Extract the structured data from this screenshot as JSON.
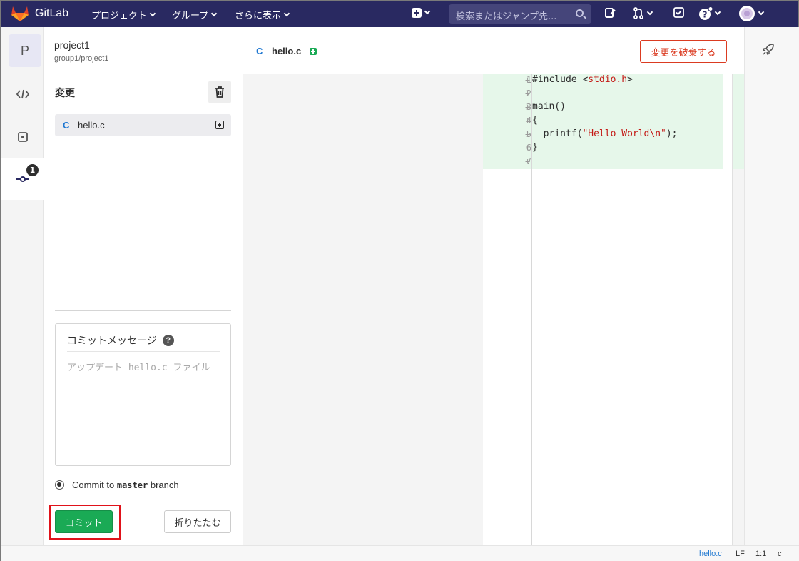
{
  "app": {
    "name": "GitLab"
  },
  "nav": {
    "projects": "プロジェクト",
    "groups": "グループ",
    "more": "さらに表示",
    "search_placeholder": "検索またはジャンプ先..."
  },
  "project": {
    "avatar_letter": "P",
    "name": "project1",
    "path": "group1/project1"
  },
  "rail": {
    "commit_badge": "1"
  },
  "changes": {
    "title": "変更",
    "files": [
      {
        "lang": "C",
        "name": "hello.c"
      }
    ]
  },
  "commit": {
    "message_label": "コミットメッセージ",
    "help": "?",
    "placeholder": "アップデート hello.c ファイル",
    "radio_prefix": "Commit to",
    "branch": "master",
    "radio_suffix": "branch",
    "commit_button": "コミット",
    "collapse_button": "折りたたむ"
  },
  "editor": {
    "tab_lang": "C",
    "tab_name": "hello.c",
    "discard_button": "変更を破棄する",
    "lines": [
      {
        "n": "1",
        "code": "#include <stdio.h>"
      },
      {
        "n": "2",
        "code": ""
      },
      {
        "n": "3",
        "code": "main()"
      },
      {
        "n": "4",
        "code": "{"
      },
      {
        "n": "5",
        "code": "  printf(\"Hello World\\n\");"
      },
      {
        "n": "6",
        "code": "}"
      },
      {
        "n": "7",
        "code": ""
      }
    ]
  },
  "status": {
    "file": "hello.c",
    "eol": "LF",
    "position": "1:1",
    "lang": "c"
  },
  "colors": {
    "navbar": "#292961",
    "commit_green": "#1aaa55",
    "discard_red": "#db3b21",
    "highlight_red": "#e0121a",
    "added_line": "#e6f7ea"
  }
}
